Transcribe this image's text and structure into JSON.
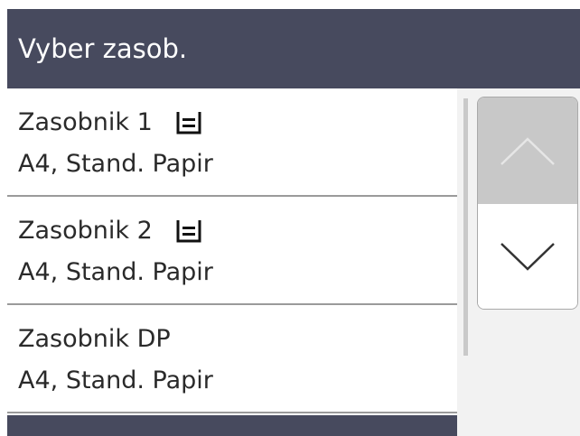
{
  "header": {
    "title": "Vyber zasob."
  },
  "trays": [
    {
      "name": "Zasobnik 1",
      "icon": "paper-tray-icon",
      "detail": "A4, Stand. Papir"
    },
    {
      "name": "Zasobnik 2",
      "icon": "paper-tray-icon",
      "detail": "A4, Stand. Papir"
    },
    {
      "name": "Zasobnik DP",
      "detail": "A4, Stand. Papir"
    }
  ],
  "scroll": {
    "up_icon": "chevron-up-icon",
    "down_icon": "chevron-down-icon",
    "up_enabled": false,
    "down_enabled": true
  },
  "colors": {
    "header_bg": "#474a5e",
    "header_text": "#ffffff",
    "disabled_button": "#c8c8c8"
  }
}
